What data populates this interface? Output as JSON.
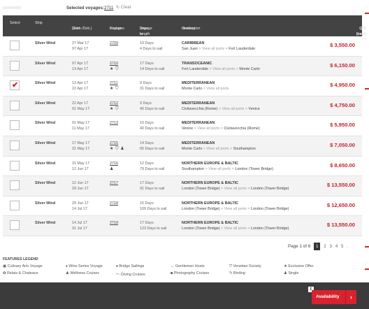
{
  "selected_bar": {
    "label": "Selected voyages:",
    "value": "2711",
    "clear": "Clear"
  },
  "header": {
    "select": "Select",
    "ship": "Ship",
    "date_1": "Date",
    "date_2": "(Emb./Deb.)",
    "voyage_1": "Voyage",
    "voyage_2": "Features",
    "length_1": "Voyage length",
    "length_2": "Days to sailing",
    "dest_1": "Destination",
    "dest_2": "Itinerary",
    "fare_1": "C/O Fares from",
    "fare_2": "(per guest)"
  },
  "rows": [
    {
      "checked": false,
      "ship": "Silver Wind",
      "emb": "27 Mar 17",
      "deb": "07 Apr 17",
      "voyage": "2709",
      "icons": "",
      "length": "10 Days",
      "sail": "4 Days to sail",
      "region": "CARIBBEAN",
      "from": "San Juan",
      "via": "View all ports",
      "to": "Fort Lauderdale",
      "price": "$ 3,550.00"
    },
    {
      "checked": false,
      "ship": "Silver Wind",
      "emb": "07 Apr 17",
      "deb": "13 Apr 17",
      "voyage": "2710",
      "icons": "★ ⛉",
      "length": "17 Days",
      "sail": "14 Days to sail",
      "region": "TRANSOCEANIC",
      "from": "Fort Lauderdale",
      "via": "View all ports",
      "to": "Monte Carlo",
      "price": "$ 6,150.00"
    },
    {
      "checked": true,
      "ship": "Silver Wind",
      "emb": "13 Apr 17",
      "deb": "22 Apr 17",
      "voyage": "2711",
      "icons": "★ ⛉",
      "length": "9 Days",
      "sail": "31 Days to sail",
      "region": "MEDITERRANEAN",
      "from": "Monte Carlo",
      "via": "View all ports",
      "to": "",
      "price": "$ 4,950.00"
    },
    {
      "checked": false,
      "ship": "Silver Wind",
      "emb": "22 Apr 17",
      "deb": "01 May 17",
      "voyage": "2712",
      "icons": "★ ⛉",
      "length": "9 Days",
      "sail": "40 Days to sail",
      "region": "MEDITERRANEAN",
      "from": "Civitavecchia (Rome)",
      "via": "View all ports",
      "to": "Venice",
      "price": "$ 4,750.00"
    },
    {
      "checked": false,
      "ship": "Silver Wind",
      "emb": "01 May 17",
      "deb": "11 May 17",
      "voyage": "2713",
      "icons": "",
      "length": "10 Days",
      "sail": "40 Days to sail",
      "region": "MEDITERRANEAN",
      "from": "Venice",
      "via": "View all ports",
      "to": "Civitavecchia (Rome)",
      "price": "$ 5,950.00"
    },
    {
      "checked": false,
      "ship": "Silver Wind",
      "emb": "17 May 17",
      "deb": "31 May 17",
      "voyage": "2715",
      "icons": "★ ⛉ ♟",
      "length": "14 Days",
      "sail": "65 Days to sail",
      "region": "MEDITERRANEAN",
      "from": "Monte Carlo",
      "via": "View all ports",
      "to": "Southampton",
      "price": "$ 7,050.00"
    },
    {
      "checked": false,
      "ship": "Silver Wind",
      "emb": "31 May 17",
      "deb": "12 Jun 17",
      "voyage": "2716",
      "icons": "♟",
      "length": "12 Days",
      "sail": "79 Days to sail",
      "region": "NORTHERN EUROPE & BALTIC",
      "from": "Southampton",
      "via": "View all ports",
      "to": "London (Tower Bridge)",
      "price": "$ 8,650.00"
    },
    {
      "checked": false,
      "ship": "Silver Wind",
      "emb": "12 Jun 17",
      "deb": "29 Jun 17",
      "voyage": "2717",
      "icons": "",
      "length": "17 Days",
      "sail": "91 Days to sail",
      "region": "NORTHERN EUROPE & BALTIC",
      "from": "London (Tower Bridge)",
      "via": "View all ports",
      "to": "London (Tower Bridge)",
      "price": "$ 13,550.00"
    },
    {
      "checked": false,
      "ship": "Silver Wind",
      "emb": "29 Jun 17",
      "deb": "14 Jul 17",
      "voyage": "2718",
      "icons": "",
      "length": "15 Days",
      "sail": "109 Days to sail",
      "region": "NORTHERN EUROPE & BALTIC",
      "from": "London (Tower Bridge)",
      "via": "View all ports",
      "to": "London (Tower Bridge)",
      "price": "$ 12,650.00"
    },
    {
      "checked": false,
      "ship": "Silver Wind",
      "emb": "14 Jul 17",
      "deb": "31 Jul 17",
      "voyage": "2719",
      "icons": "",
      "length": "17 Days",
      "sail": "123 Days to sail",
      "region": "NORTHERN EUROPE & BALTIC",
      "from": "London (Tower Bridge)",
      "via": "View all ports",
      "to": "London (Tower Bridge)",
      "price": "$ 13,550.00"
    }
  ],
  "pager": {
    "label": "Page 1 of 6",
    "current": "1",
    "pages": [
      "2",
      "3",
      "4",
      "5"
    ],
    "more": "."
  },
  "legend": {
    "title": "FEATURES LEGEND",
    "items": [
      {
        "icon": "▣",
        "label": "Culinary Arts Voyage"
      },
      {
        "icon": "♦",
        "label": "Wine Series Voyage"
      },
      {
        "icon": "♠",
        "label": "Bridge Sailings"
      },
      {
        "icon": "↔",
        "label": "Gentlemen Hosts"
      },
      {
        "icon": "⛉",
        "label": "Venetian Society"
      },
      {
        "icon": "★",
        "label": "Exclusive Offer"
      },
      {
        "icon": "✿",
        "label": "Relais & Chateaux"
      },
      {
        "icon": "♟",
        "label": "Wellness Cruises"
      },
      {
        "icon": "〜",
        "label": "Diving Cruises"
      },
      {
        "icon": "◙",
        "label": "Photography Cruises"
      },
      {
        "icon": "✎",
        "label": "Birding"
      },
      {
        "icon": "♟",
        "label": "Single"
      }
    ]
  },
  "footer": {
    "availability": "Availability",
    "arrow": "›",
    "mini": "F"
  },
  "colors": {
    "accent": "#d9222d",
    "header_bg": "#434343",
    "footer_bg": "#3b3b3b"
  }
}
